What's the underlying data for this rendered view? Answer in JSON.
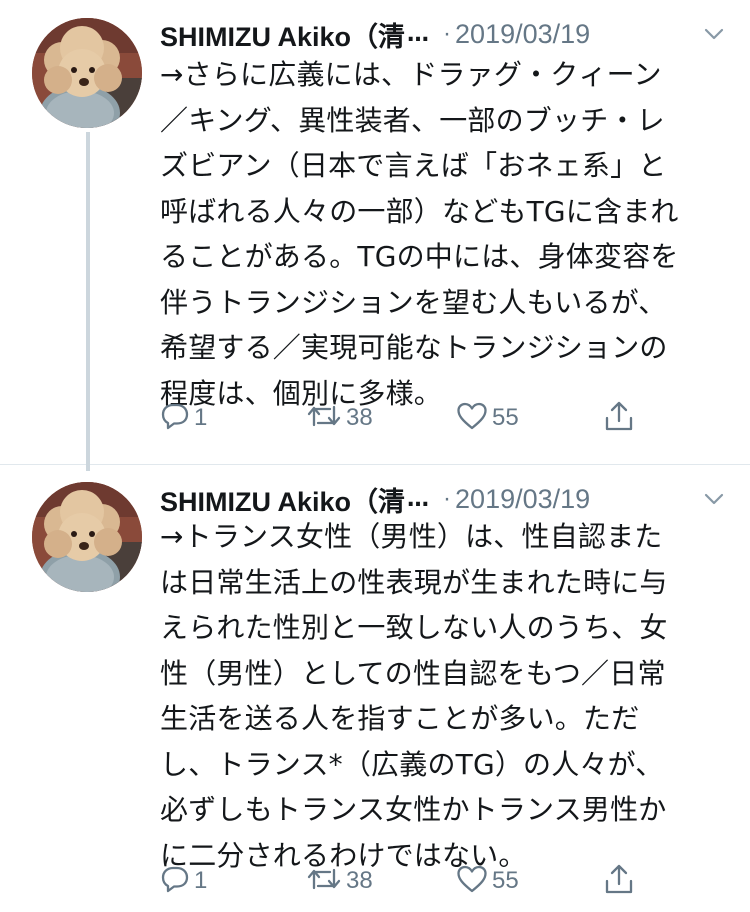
{
  "tweets": [
    {
      "author_name": "SHIMIZU Akiko（清",
      "ellipsis": "…",
      "separator": "·",
      "date": "2019/03/19",
      "lines": [
        "→さらに広義には、ドラァグ・クィーン",
        "／キング、異性装者、一部のブッチ・レ",
        "ズビアン（日本で言えば「おネェ系」と",
        "呼ばれる人々の一部）などもTGに含まれ",
        "ることがある。TGの中には、身体変容を",
        "伴うトランジションを望む人もいるが、",
        "希望する／実現可能なトランジションの",
        "程度は、個別に多様。"
      ],
      "actions": {
        "reply_count": "1",
        "retweet_count": "38",
        "like_count": "55"
      }
    },
    {
      "author_name": "SHIMIZU Akiko（清",
      "ellipsis": "…",
      "separator": "·",
      "date": "2019/03/19",
      "lines": [
        "→トランス女性（男性）は、性自認また",
        "は日常生活上の性表現が生まれた時に与",
        "えられた性別と一致しない人のうち、女",
        "性（男性）としての性自認をもつ／日常",
        "生活を送る人を指すことが多い。ただ",
        "し、トランス*（広義のTG）の人々が、",
        "必ずしもトランス女性かトランス男性か",
        "に二分されるわけではない。"
      ],
      "actions": {
        "reply_count": "1",
        "retweet_count": "38",
        "like_count": "55"
      }
    }
  ],
  "icons": {
    "reply": "reply-icon",
    "retweet": "retweet-icon",
    "like": "heart-icon",
    "share": "share-icon",
    "more": "chevron-down-icon",
    "avatar": "poodle-avatar"
  },
  "colors": {
    "text": "#14171a",
    "secondary": "#657786",
    "thread_line": "#ccd6dd",
    "divider": "#e1e8ed"
  }
}
